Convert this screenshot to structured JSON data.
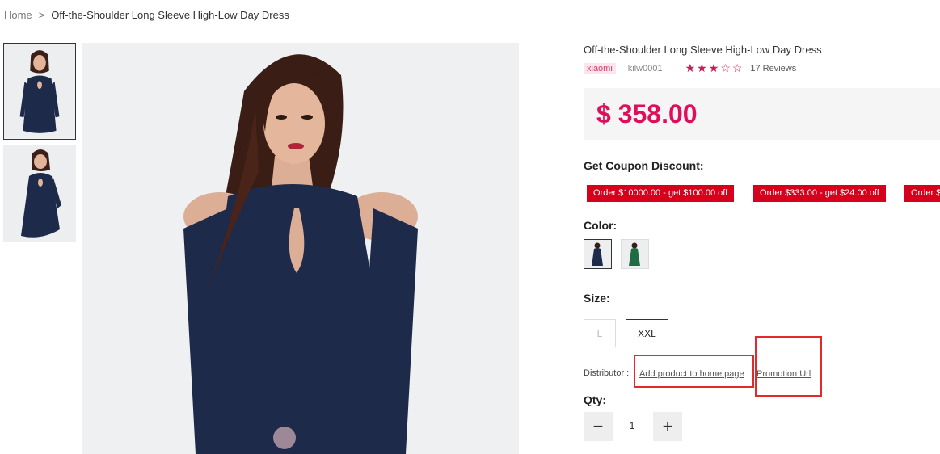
{
  "breadcrumb": {
    "home": "Home",
    "separator": ">",
    "current": "Off-the-Shoulder Long Sleeve High-Low Day Dress"
  },
  "product": {
    "title": "Off-the-Shoulder Long Sleeve High-Low Day Dress",
    "brand": "xiaomi",
    "sku": "kilw0001",
    "rating": 3,
    "rating_max": 5,
    "stars_text": "★★★☆☆",
    "reviews": "17 Reviews",
    "price": "$ 358.00"
  },
  "coupon": {
    "label": "Get Coupon Discount:",
    "items": [
      "Order $10000.00 - get $100.00 off",
      "Order $333.00 - get $24.00 off",
      "Order $"
    ]
  },
  "color": {
    "label": "Color:",
    "options": [
      {
        "name": "navy",
        "swatch": "#1e2a4a",
        "selected": true
      },
      {
        "name": "green",
        "swatch": "#1f6b43",
        "selected": false
      }
    ]
  },
  "size": {
    "label": "Size:",
    "options": [
      {
        "label": "L",
        "disabled": true,
        "selected": false
      },
      {
        "label": "XXL",
        "disabled": false,
        "selected": true
      }
    ]
  },
  "distributor": {
    "label": "Distributor :",
    "add_home": "Add product to home page",
    "promotion": "Promotion Url"
  },
  "qty": {
    "label": "Qty:",
    "minus": "−",
    "plus": "+",
    "value": "1"
  },
  "colors": {
    "accent": "#e10d5a",
    "coupon": "#d6001c",
    "highlight": "#e4292a",
    "dress": "#1e2a4a"
  }
}
